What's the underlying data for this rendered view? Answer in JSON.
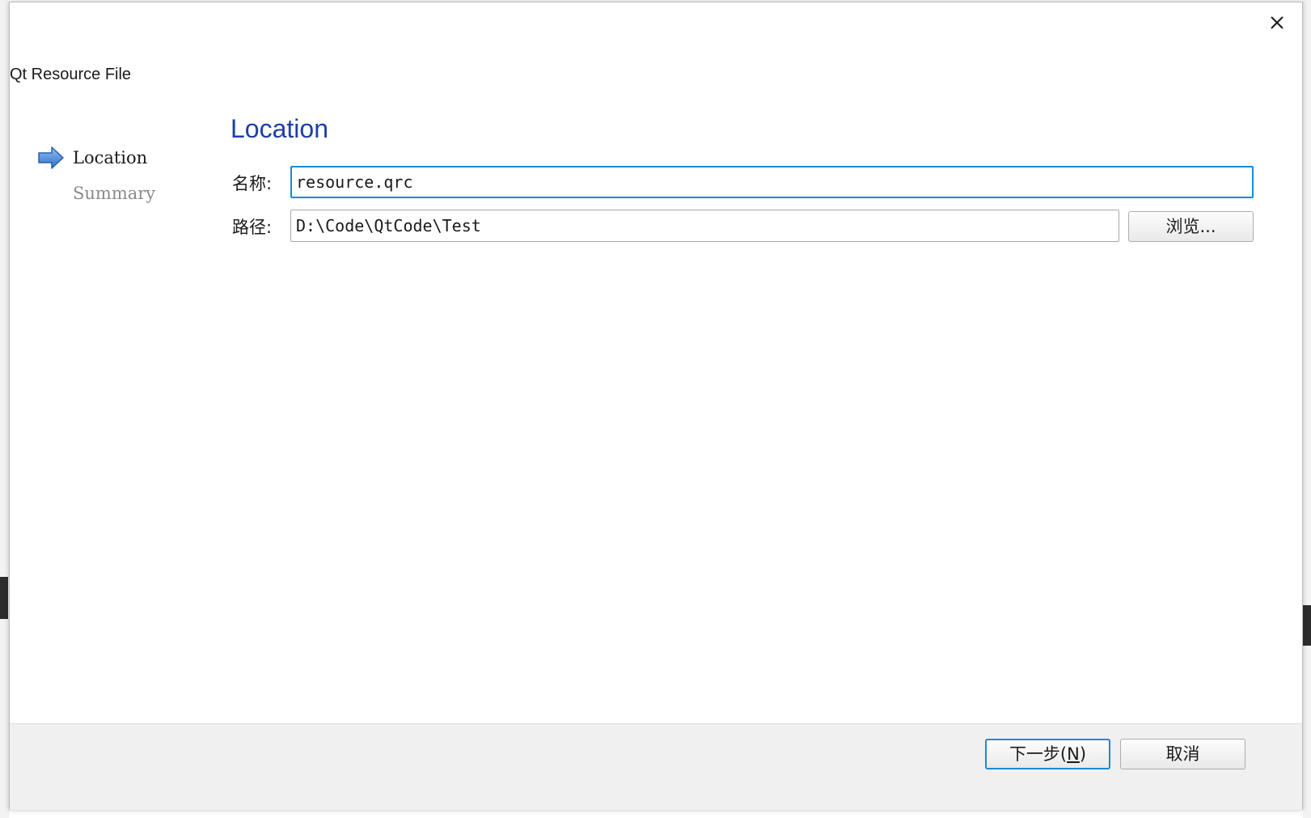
{
  "window": {
    "title": "Qt Resource File"
  },
  "wizard": {
    "steps": [
      {
        "label": "Location",
        "state": "current"
      },
      {
        "label": "Summary",
        "state": "pending"
      }
    ],
    "page_heading": "Location"
  },
  "form": {
    "name_label": "名称:",
    "name_value": "resource.qrc",
    "path_label": "路径:",
    "path_value": "D:\\Code\\QtCode\\Test",
    "browse_label": "浏览..."
  },
  "footer": {
    "next_label_prefix": "下一步(",
    "next_mnemonic": "N",
    "next_label_suffix": ")",
    "cancel_label": "取消"
  },
  "colors": {
    "heading": "#1e3fa8",
    "focus_border": "#1a8ad8",
    "step_arrow": "#3a7fd6",
    "pending_text": "#8a8a8a"
  },
  "icons": {
    "close": "close-icon",
    "current_step": "arrow-right-icon"
  }
}
